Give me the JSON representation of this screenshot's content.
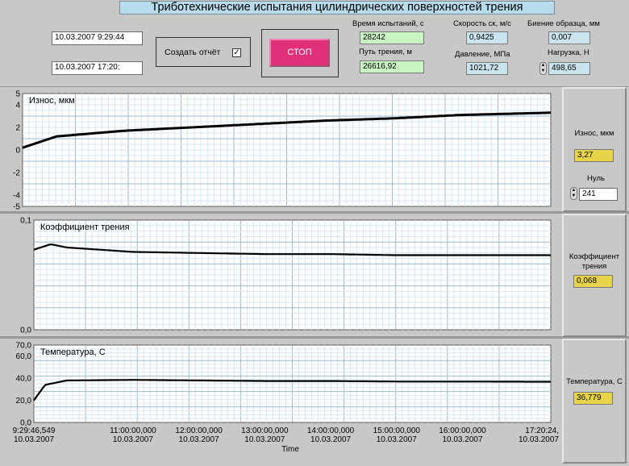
{
  "title": "Триботехнические испытания цилиндрических поверхностей трения",
  "controls": {
    "start_time": "10.03.2007  9:29:44",
    "end_time": "10.03.2007  17:20:",
    "report_label": "Создать отчёт",
    "report_checked": "✓",
    "stop_label": "СТОП"
  },
  "indicators": {
    "test_time_label": "Время испытаний, с",
    "test_time_value": "28242",
    "path_label": "Путь трения, м",
    "path_value": "26616,92",
    "speed_label": "Скорость ск, м/с",
    "speed_value": "0,9425",
    "pressure_label": "Давление, МПа",
    "pressure_value": "1021,72",
    "runout_label": "Биение образца, мм",
    "runout_value": "0,007",
    "load_label": "Нагрузка, Н",
    "load_value": "498,65"
  },
  "side": {
    "wear_label": "Износ, мкм",
    "wear_value": "3,27",
    "zero_label": "Нуль",
    "zero_value": "241",
    "friction_label_1": "Коэффициент",
    "friction_label_2": "трения",
    "friction_value": "0,068",
    "temp_label": "Температура, С",
    "temp_value": "36,779"
  },
  "time_axis": {
    "label": "Time",
    "ticks": [
      {
        "time": "9:29:46,549",
        "date": "10.03.2007"
      },
      {
        "time": "11:00:00,000",
        "date": "10.03.2007"
      },
      {
        "time": "12:00:00,000",
        "date": "10.03.2007"
      },
      {
        "time": "13:00:00,000",
        "date": "10.03.2007"
      },
      {
        "time": "14:00:00,000",
        "date": "10.03.2007"
      },
      {
        "time": "15:00:00,000",
        "date": "10.03.2007"
      },
      {
        "time": "16:00:00,000",
        "date": "10.03.2007"
      },
      {
        "time": "17:20:24,",
        "date": "10.03.2007"
      }
    ]
  },
  "chart_data": [
    {
      "type": "line",
      "title": "Износ, мкм",
      "ylim": [
        -5,
        5
      ],
      "y_ticks": [
        "5",
        "4",
        "2",
        "0",
        "-2",
        "-4",
        "-5"
      ],
      "x": [
        "9:29:46",
        "10:00",
        "11:00",
        "12:00",
        "13:00",
        "14:00",
        "15:00",
        "16:00",
        "17:20"
      ],
      "series": [
        {
          "values": [
            0.2,
            1.2,
            1.7,
            2.0,
            2.3,
            2.6,
            2.8,
            3.1,
            3.3
          ]
        }
      ],
      "grid": true,
      "color": "#000000"
    },
    {
      "type": "line",
      "title": "Коэффициент трения",
      "ylim": [
        0,
        0.1
      ],
      "y_ticks": [
        "0,1",
        "0,0"
      ],
      "x": [
        "9:29:46",
        "9:45",
        "10:00",
        "11:00",
        "12:00",
        "13:00",
        "14:00",
        "15:00",
        "16:00",
        "17:20"
      ],
      "series": [
        {
          "values": [
            0.073,
            0.078,
            0.075,
            0.071,
            0.07,
            0.069,
            0.069,
            0.068,
            0.068,
            0.068
          ]
        }
      ],
      "grid": true,
      "color": "#000000"
    },
    {
      "type": "line",
      "title": "Температура, С",
      "ylim": [
        0,
        70
      ],
      "y_ticks": [
        "70,0",
        "60,0",
        "40,0",
        "20,0",
        "0,0"
      ],
      "x": [
        "9:29:46",
        "9:40",
        "10:00",
        "11:00",
        "12:00",
        "13:00",
        "14:00",
        "15:00",
        "16:00",
        "17:20"
      ],
      "series": [
        {
          "values": [
            20,
            34,
            38,
            38.5,
            38,
            37.5,
            37.5,
            37,
            37,
            36.8
          ]
        }
      ],
      "grid": true,
      "color": "#000000"
    }
  ]
}
